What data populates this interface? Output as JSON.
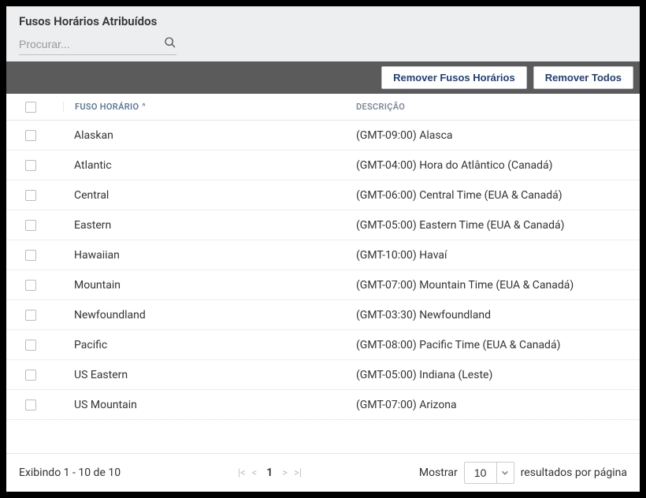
{
  "header": {
    "title": "Fusos Horários Atribuídos",
    "search_placeholder": "Procurar..."
  },
  "toolbar": {
    "remove_selected": "Remover Fusos Horários",
    "remove_all": "Remover Todos"
  },
  "table": {
    "col_timezone": "FUSO HORÁRIO",
    "sort_indicator": "^",
    "col_description": "DESCRIÇÃO",
    "rows": [
      {
        "tz": "Alaskan",
        "desc": "(GMT-09:00) Alasca"
      },
      {
        "tz": "Atlantic",
        "desc": "(GMT-04:00) Hora do Atlântico (Canadá)"
      },
      {
        "tz": "Central",
        "desc": "(GMT-06:00) Central Time (EUA & Canadá)"
      },
      {
        "tz": "Eastern",
        "desc": "(GMT-05:00) Eastern Time (EUA & Canadá)"
      },
      {
        "tz": "Hawaiian",
        "desc": "(GMT-10:00) Havaí"
      },
      {
        "tz": "Mountain",
        "desc": "(GMT-07:00) Mountain Time (EUA & Canadá)"
      },
      {
        "tz": "Newfoundland",
        "desc": "(GMT-03:30) Newfoundland"
      },
      {
        "tz": "Pacific",
        "desc": "(GMT-08:00) Pacific Time (EUA & Canadá)"
      },
      {
        "tz": "US Eastern",
        "desc": "(GMT-05:00) Indiana (Leste)"
      },
      {
        "tz": "US Mountain",
        "desc": "(GMT-07:00) Arizona"
      }
    ]
  },
  "footer": {
    "showing": "Exibindo 1 - 10 de 10",
    "current_page": "1",
    "show_label": "Mostrar",
    "page_size": "10",
    "results_label": "resultados por página"
  }
}
